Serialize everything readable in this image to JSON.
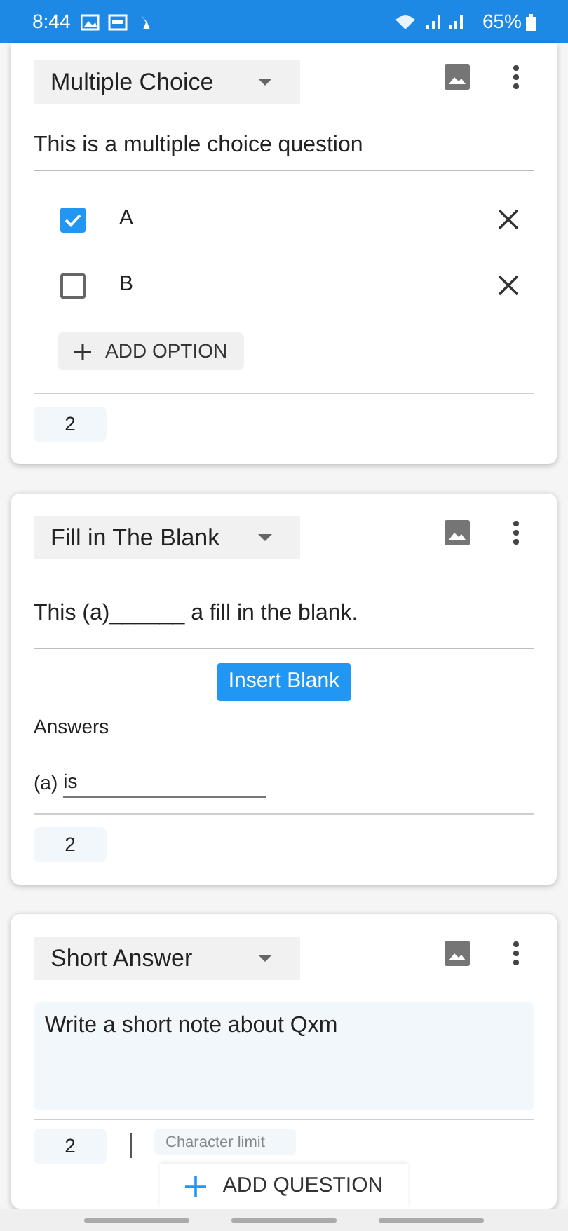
{
  "status_bar": {
    "time": "8:44",
    "battery": "65%"
  },
  "questions": [
    {
      "kind": "multiple_choice",
      "type_label": "Multiple Choice",
      "question": "This is a multiple choice question",
      "options": [
        {
          "label": "A",
          "checked": true
        },
        {
          "label": "B",
          "checked": false
        }
      ],
      "add_option": "ADD OPTION",
      "points": "2"
    },
    {
      "kind": "fill_blank",
      "type_label": "Fill in The Blank",
      "question": "This (a)______ a fill in the blank.",
      "insert_button": "Insert Blank",
      "answers_label": "Answers",
      "answers": [
        {
          "key": "(a)",
          "value": "is"
        }
      ],
      "points": "2"
    },
    {
      "kind": "short_answer",
      "type_label": "Short Answer",
      "question": "Write a short note about Qxm",
      "points": "2",
      "limit_placeholder": "Character limit"
    }
  ],
  "add_question": "ADD QUESTION"
}
